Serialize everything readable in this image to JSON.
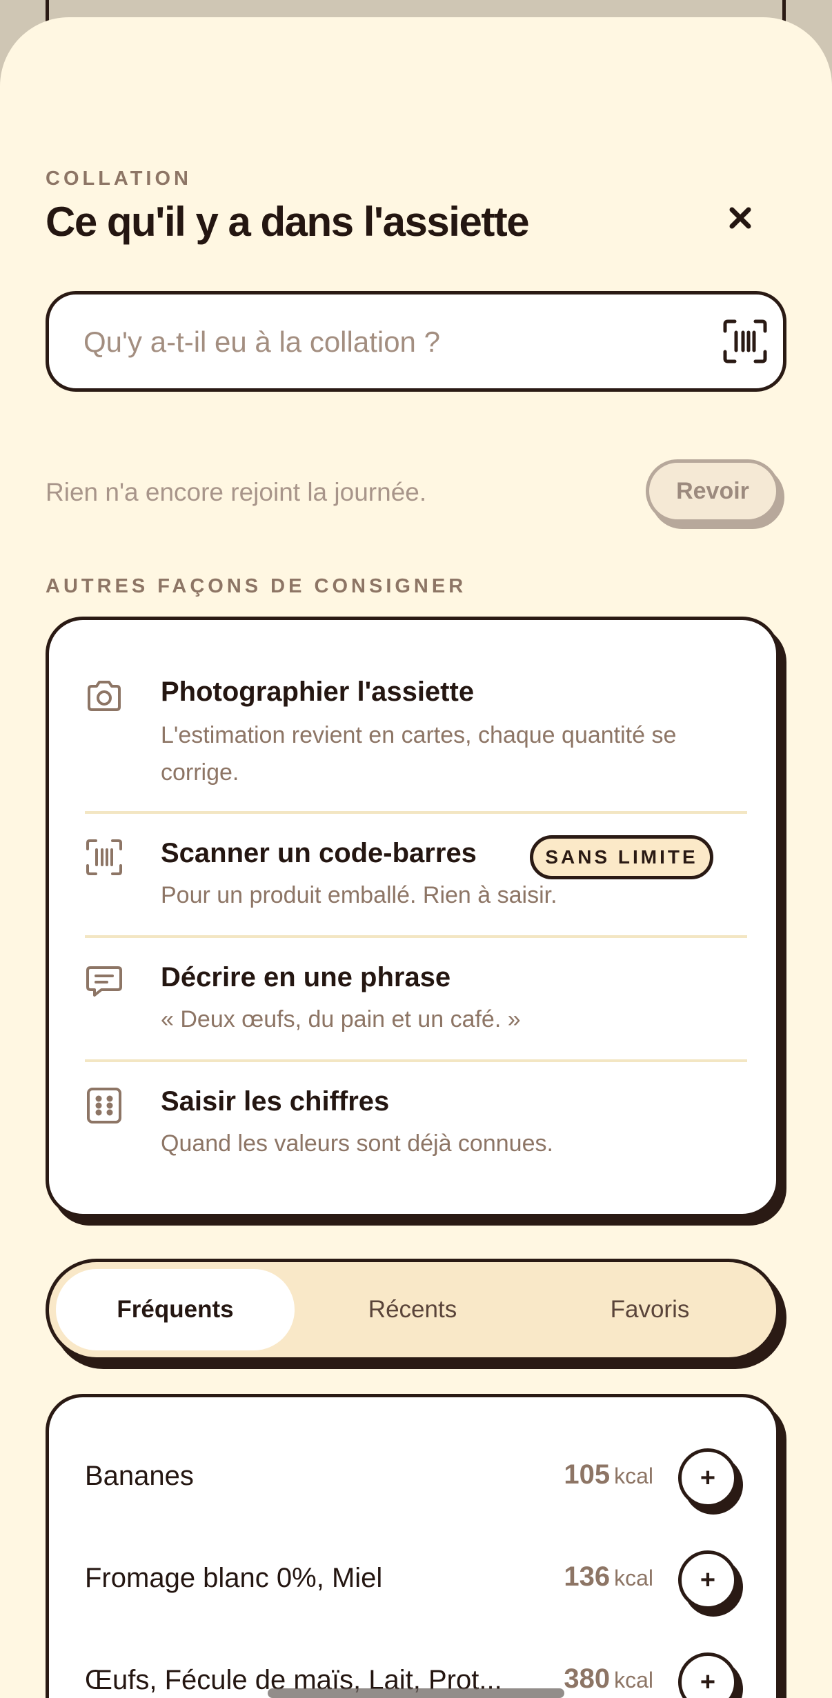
{
  "header": {
    "kicker": "COLLATION",
    "title": "Ce qu'il y a dans l'assiette"
  },
  "search": {
    "placeholder": "Qu'y a-t-il eu à la collation ?",
    "value": ""
  },
  "summary": {
    "empty_text": "Rien n'a encore rejoint la journée.",
    "review_label": "Revoir"
  },
  "methods": {
    "section_label": "AUTRES FAÇONS DE CONSIGNER",
    "items": [
      {
        "icon": "camera-icon",
        "title": "Photographier l'assiette",
        "description": "L'estimation revient en cartes, chaque quantité se corrige."
      },
      {
        "icon": "barcode-icon",
        "title": "Scanner un code-barres",
        "description": "Pour un produit emballé. Rien à saisir.",
        "badge": "SANS LIMITE"
      },
      {
        "icon": "chat-icon",
        "title": "Décrire en une phrase",
        "description": "« Deux œufs, du pain et un café. »"
      },
      {
        "icon": "keypad-icon",
        "title": "Saisir les chiffres",
        "description": "Quand les valeurs sont déjà connues."
      }
    ]
  },
  "tabs": {
    "items": [
      {
        "label": "Fréquents",
        "active": true
      },
      {
        "label": "Récents",
        "active": false
      },
      {
        "label": "Favoris",
        "active": false
      }
    ]
  },
  "foods": {
    "unit": "kcal",
    "items": [
      {
        "name": "Bananes",
        "kcal": "105"
      },
      {
        "name": "Fromage blanc 0%, Miel",
        "kcal": "136"
      },
      {
        "name": "Œufs, Fécule de maïs, Lait, Prot...",
        "kcal": "380"
      }
    ],
    "add_label": "+"
  },
  "colors": {
    "background": "#fff7e2",
    "ink": "#2a1a14",
    "muted": "#8d7565",
    "accent_soft": "#f9e8c8"
  }
}
